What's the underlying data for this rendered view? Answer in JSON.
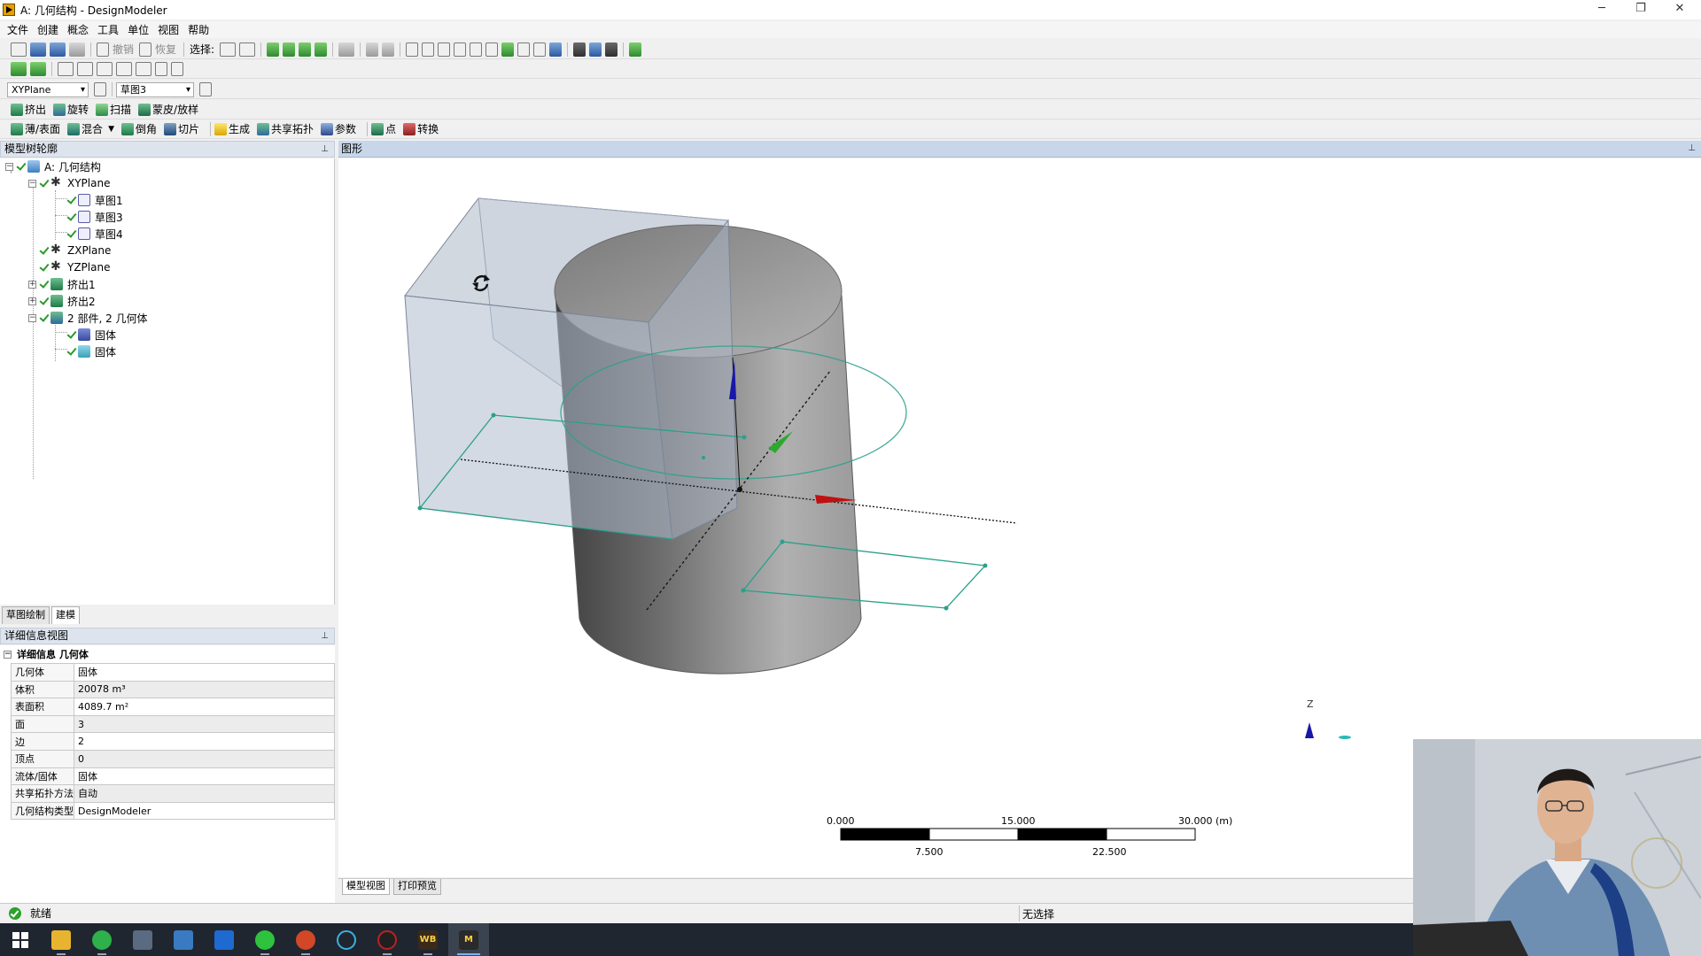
{
  "window": {
    "title": "A: 几何结构 - DesignModeler",
    "controls": [
      "─",
      "❐",
      "✕"
    ]
  },
  "menu": [
    "文件",
    "创建",
    "概念",
    "工具",
    "单位",
    "视图",
    "帮助"
  ],
  "toolbar1": {
    "undo": "撤销",
    "redo": "恢复",
    "select_label": "选择:"
  },
  "toolbar2": {
    "plane": "XYPlane",
    "sketch": "草图3"
  },
  "toolbar3": [
    "挤出",
    "旋转",
    "扫描",
    "蒙皮/放样"
  ],
  "toolbar4": [
    "薄/表面",
    "混合",
    "倒角",
    "切片",
    "生成",
    "共享拓扑",
    "参数",
    "点",
    "转换"
  ],
  "tree": {
    "header": "模型树轮廓",
    "items": [
      {
        "label": "A: 几何结构"
      },
      {
        "label": "XYPlane"
      },
      {
        "label": "草图1"
      },
      {
        "label": "草图3"
      },
      {
        "label": "草图4"
      },
      {
        "label": "ZXPlane"
      },
      {
        "label": "YZPlane"
      },
      {
        "label": "挤出1"
      },
      {
        "label": "挤出2"
      },
      {
        "label": "2 部件, 2 几何体"
      },
      {
        "label": "固体"
      },
      {
        "label": "固体"
      }
    ]
  },
  "left_tabs": [
    "草图绘制",
    "建模"
  ],
  "details": {
    "header": "详细信息视图",
    "title": "详细信息 几何体",
    "rows": [
      {
        "key": "几何体",
        "value": "固体"
      },
      {
        "key": "体积",
        "value": "20078 m³"
      },
      {
        "key": "表面积",
        "value": "4089.7 m²"
      },
      {
        "key": "面",
        "value": "3"
      },
      {
        "key": "边",
        "value": "2"
      },
      {
        "key": "顶点",
        "value": "0"
      },
      {
        "key": "流体/固体",
        "value": "固体"
      },
      {
        "key": "共享拓扑方法",
        "value": "自动"
      },
      {
        "key": "几何结构类型",
        "value": "DesignModeler"
      }
    ]
  },
  "graphics": {
    "header": "图形",
    "triad_label": "Z",
    "scale": {
      "top_labels": [
        "0.000",
        "15.000",
        "30.000 (m)"
      ],
      "bottom_labels": [
        "7.500",
        "22.500"
      ]
    },
    "tabs": [
      "模型视图",
      "打印预览"
    ]
  },
  "status": {
    "text": "就绪",
    "selection": "无选择"
  },
  "taskbar": {
    "apps": [
      "windows-start",
      "file-explorer",
      "browser",
      "calculator",
      "photos",
      "store",
      "wechat",
      "powerpoint",
      "search",
      "recorder",
      "workbench",
      "mechanical"
    ],
    "wb_label": "WB",
    "m_label": "M"
  },
  "colors": {
    "x_axis": "#c01010",
    "y_axis": "#2ea82e",
    "z_axis": "#1818a8",
    "sketch": "#2aa08a",
    "box": "#b7c4d8",
    "cylinder": "#8c8c8c"
  }
}
